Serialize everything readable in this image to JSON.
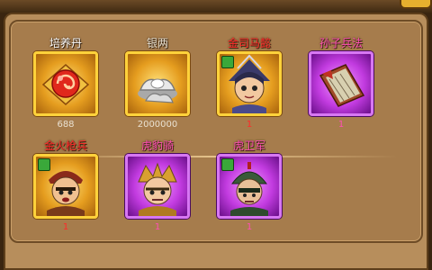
{
  "window": {
    "title": ""
  },
  "items": [
    {
      "name": "培养丹",
      "count": "688",
      "icon": "red-swirl-orb-icon"
    },
    {
      "name": "银两",
      "count": "2000000",
      "icon": "silver-ingots-icon"
    },
    {
      "name": "金司马懿",
      "count": "1",
      "icon": "sima-yi-portrait-icon"
    },
    {
      "name": "孙子兵法",
      "count": "1",
      "icon": "art-of-war-scroll-icon"
    },
    {
      "name": "金火枪兵",
      "count": "1",
      "icon": "musketeer-portrait-icon"
    },
    {
      "name": "虎豹骑",
      "count": "1",
      "icon": "tiger-cavalry-portrait-icon"
    },
    {
      "name": "虎卫军",
      "count": "1",
      "icon": "tiger-guard-portrait-icon"
    }
  ],
  "colors": {
    "gold_frame": "#ffd23b",
    "purple_frame": "#d777f3",
    "name_red": "#ff2a2a",
    "name_pink": "#ff4fb5"
  }
}
